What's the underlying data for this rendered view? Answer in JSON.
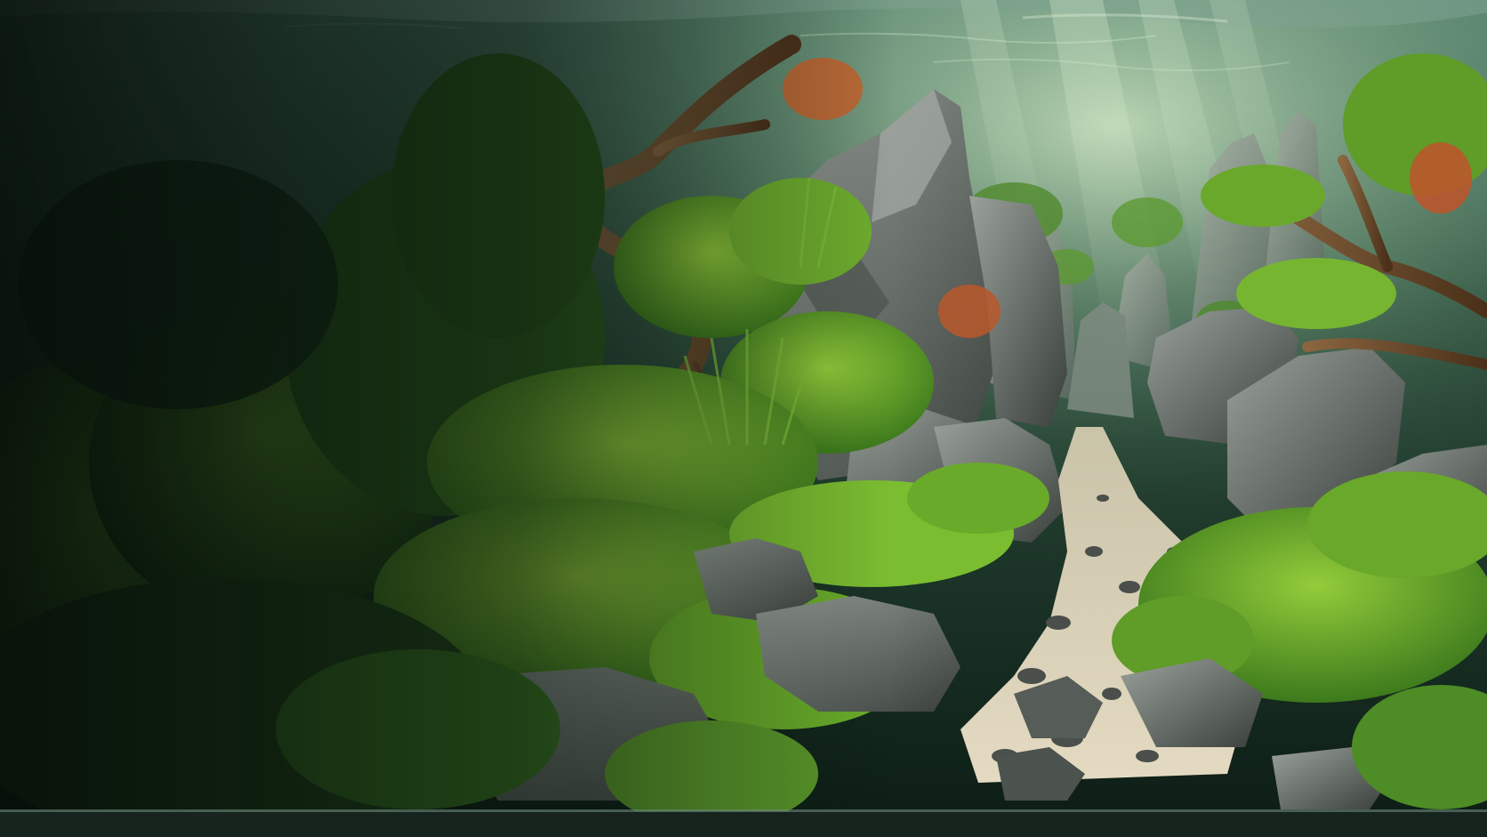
{
  "scene": {
    "subject": "aquascape",
    "palette": {
      "water_top": "#5f8a78",
      "water_deep": "#0d1f17",
      "light_rays": "#d9f2d0",
      "moss_bright": "#7fbf2e",
      "moss_dark": "#1f4a16",
      "rock": "#6f7570",
      "rock_dark": "#3b403c",
      "driftwood": "#6b4a2b",
      "sand": "#d8cdb4",
      "red_plants": "#c8502a"
    }
  }
}
